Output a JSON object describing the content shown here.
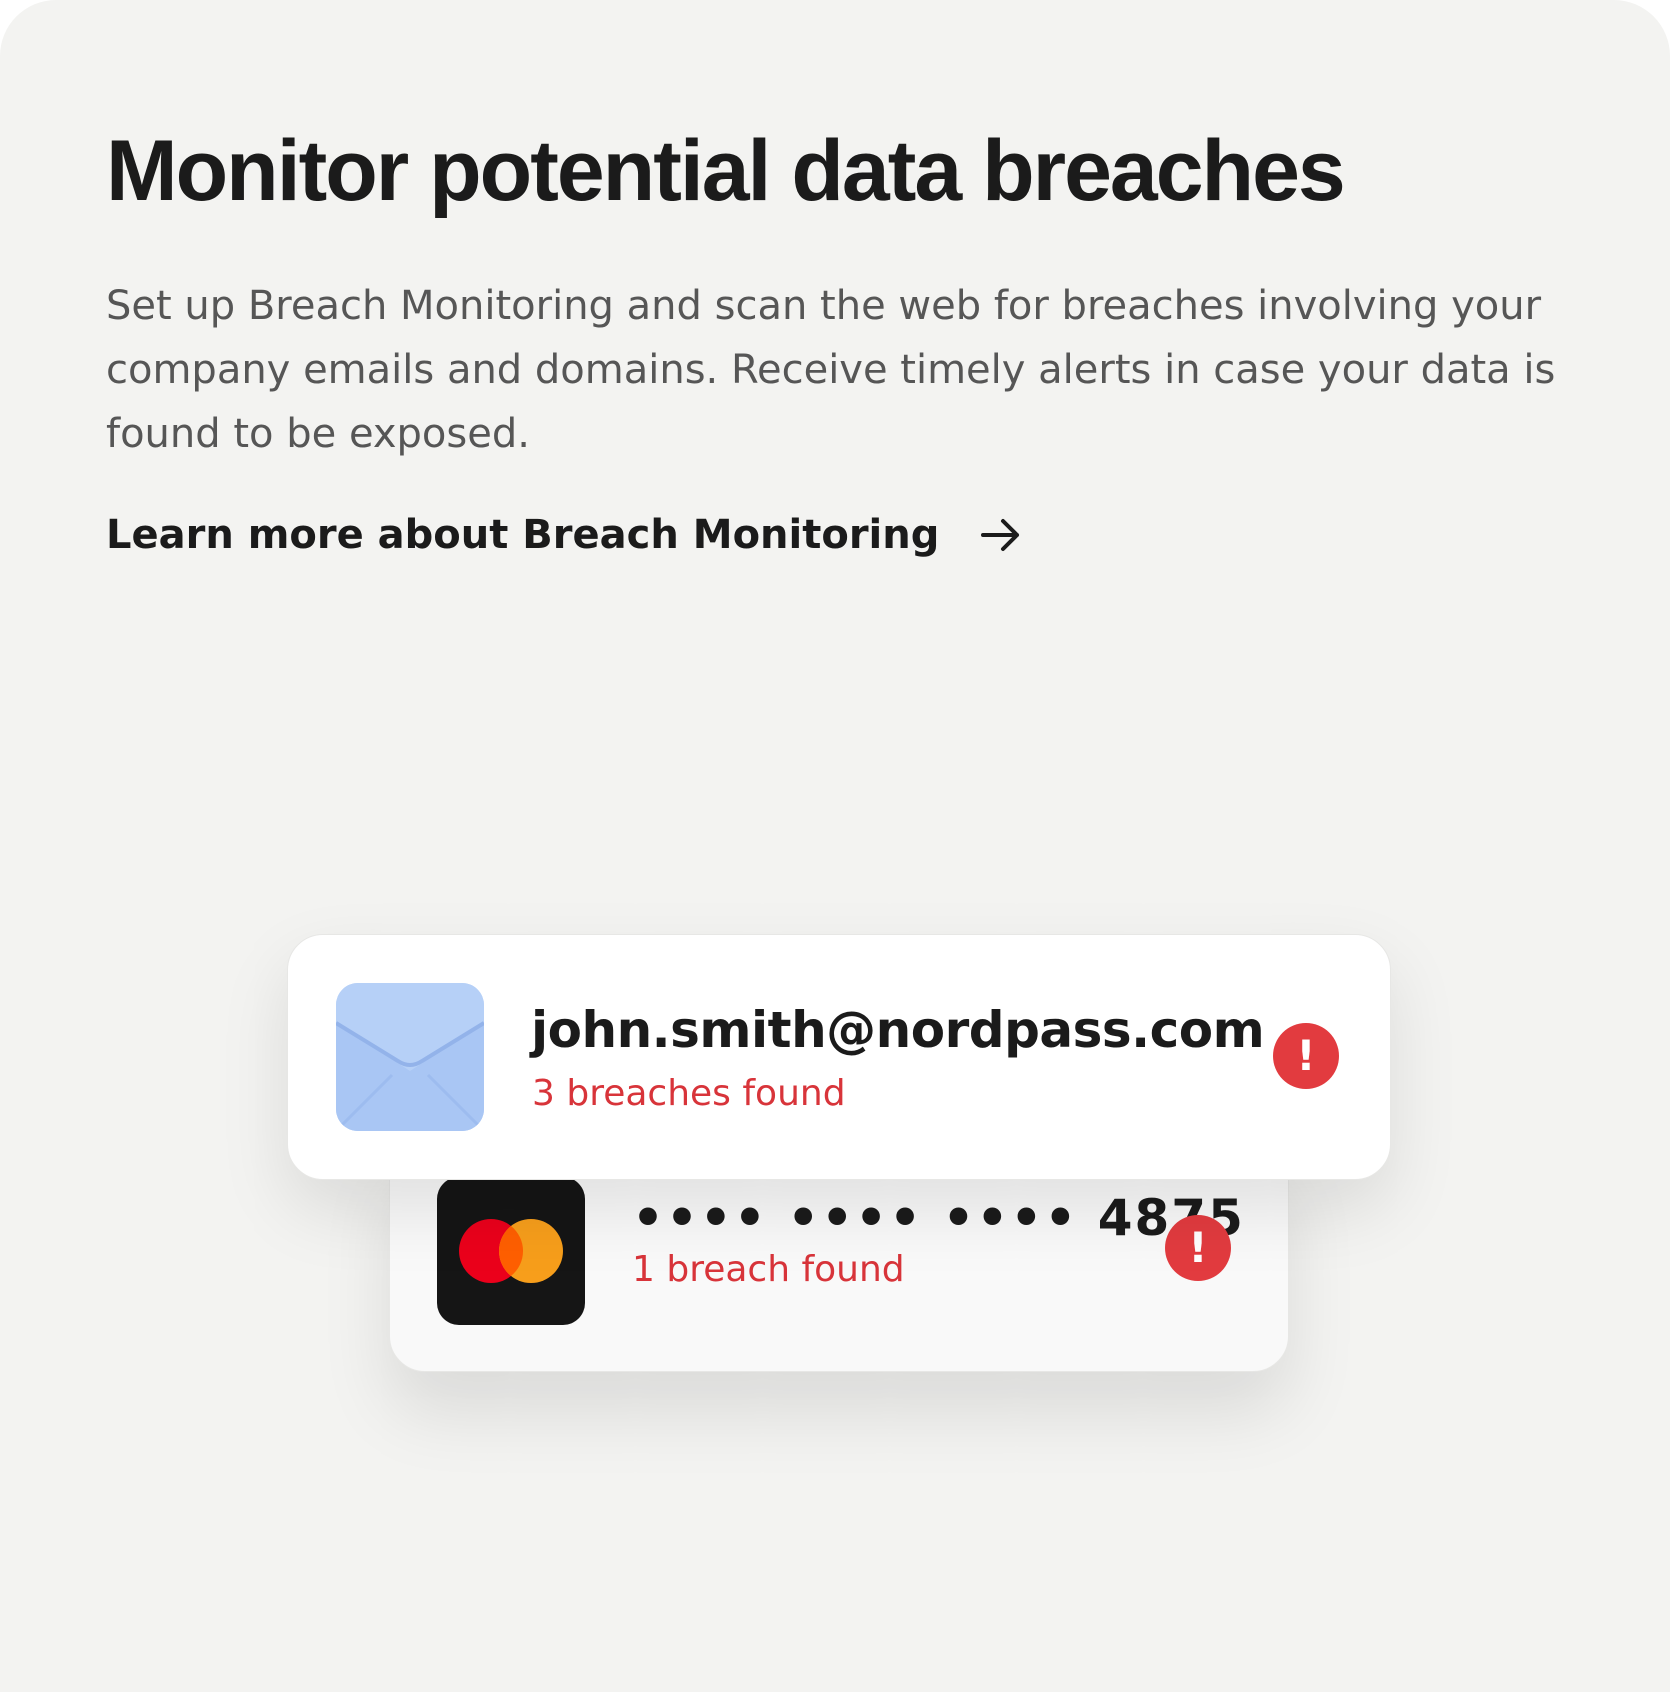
{
  "heading": {
    "title": "Monitor potential data breaches",
    "description": "Set up Breach Monitoring and scan the web for breaches involving your company emails and domains. Receive timely alerts in case your data is found to be exposed."
  },
  "learn_more": {
    "label": "Learn more about Breach Monitoring",
    "icon": "arrow-right-icon"
  },
  "breach_items": [
    {
      "value": "john.smith@nordpass.com",
      "status": "3 breaches found",
      "thumb_icon": "envelope-icon",
      "alert_icon": "exclamation-icon",
      "alert_glyph": "!"
    },
    {
      "value": "•••• •••• •••• 4875",
      "status": "1 breach found",
      "thumb_icon": "mastercard-icon",
      "alert_icon": "exclamation-icon",
      "alert_glyph": "!"
    }
  ],
  "colors": {
    "background": "#f3f3f1",
    "heading": "#1b1b1b",
    "body_text": "#565656",
    "alert_red": "#e23b3f",
    "status_red": "#d8343a",
    "envelope_blue": "#b6d0f7",
    "mastercard_red": "#eb001b",
    "mastercard_orange": "#f79e1b"
  }
}
